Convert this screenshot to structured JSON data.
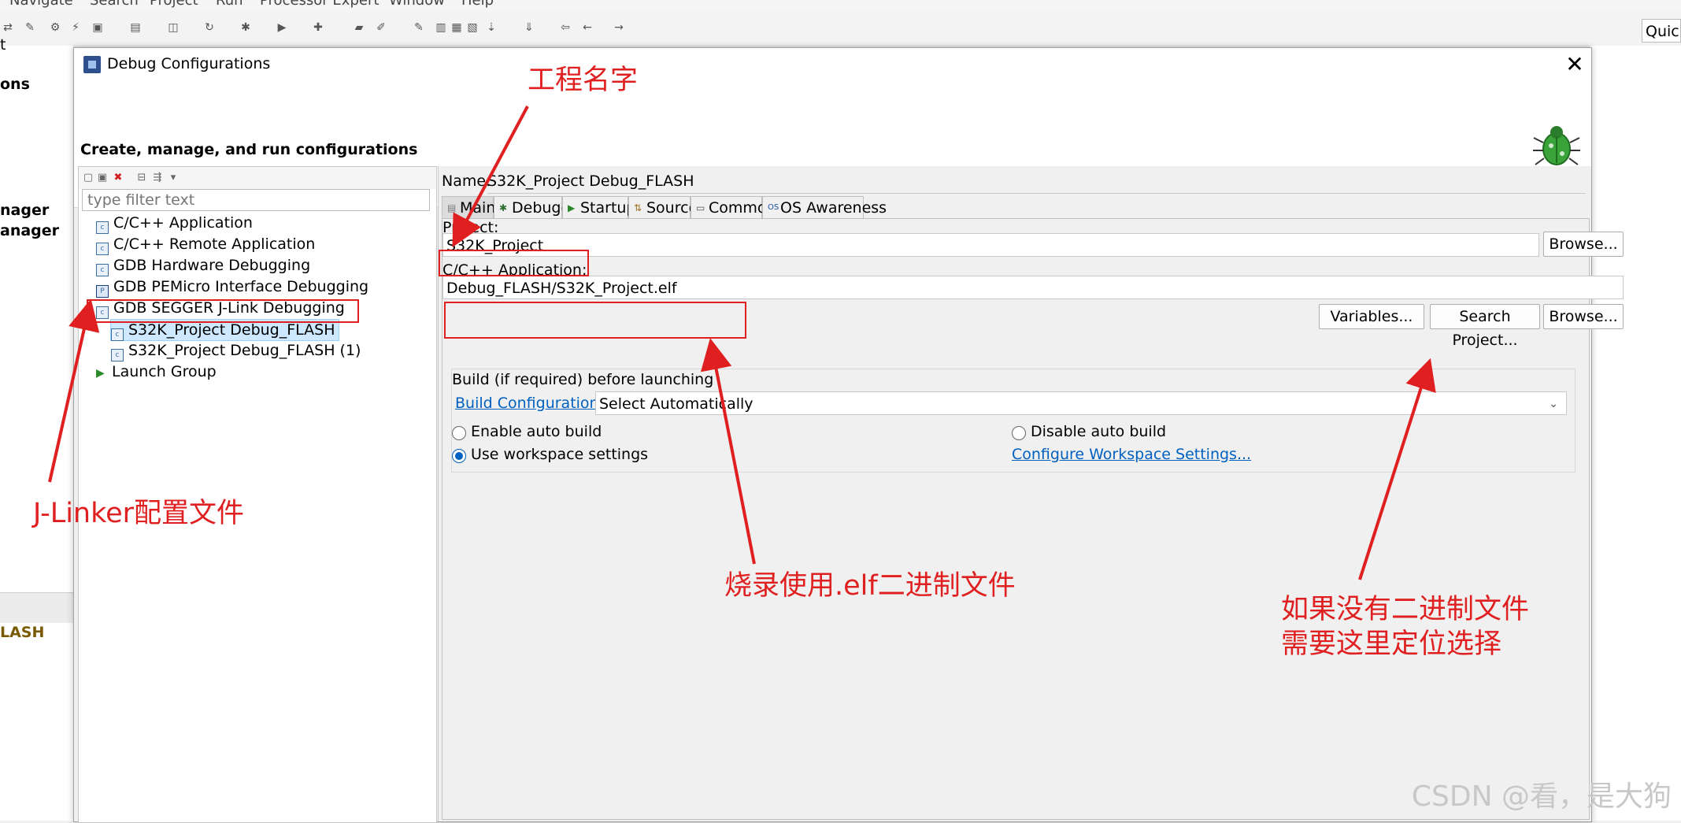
{
  "app": {
    "menubar": [
      "Navigate",
      "Search",
      "Project",
      "Run",
      "Processor Expert",
      "Window",
      "Help"
    ],
    "quick_access": "Quick",
    "bg_left_labels": [
      "ons",
      "nager",
      "anager",
      "LASH"
    ],
    "bg_tab_label": "t"
  },
  "dialog": {
    "title": "Debug Configurations",
    "header": "Create, manage, and run configurations",
    "close": "✕"
  },
  "left": {
    "filter_placeholder": "type filter text",
    "tree": [
      {
        "label": "C/C++ Application"
      },
      {
        "label": "C/C++ Remote Application"
      },
      {
        "label": "GDB Hardware Debugging"
      },
      {
        "label": "GDB PEMicro Interface Debugging"
      },
      {
        "label": "GDB SEGGER J-Link Debugging"
      },
      {
        "label": "S32K_Project Debug_FLASH"
      },
      {
        "label": "S32K_Project Debug_FLASH (1)"
      },
      {
        "label": "Launch Group"
      }
    ]
  },
  "right": {
    "name_label": "Name:",
    "name_value": "S32K_Project Debug_FLASH",
    "tabs": [
      "Main",
      "Debugger",
      "Startup",
      "Source",
      "Common",
      "OS Awareness"
    ],
    "project_label": "Project:",
    "project_value": "S32K_Project",
    "browse": "Browse...",
    "app_label": "C/C++ Application:",
    "app_value": "Debug_FLASH/S32K_Project.elf",
    "variables": "Variables...",
    "search_project": "Search Project...",
    "browse2": "Browse...",
    "build_group": "Build (if required) before launching",
    "build_config_link": "Build Configuration:",
    "build_config_value": "Select Automatically",
    "enable_auto": "Enable auto build",
    "disable_auto": "Disable auto build",
    "use_workspace": "Use workspace settings",
    "configure_ws": "Configure Workspace Settings..."
  },
  "annotations": {
    "project_name": "工程名字",
    "jlinker": "J-Linker配置文件",
    "elf": "烧录使用.elf二进制文件",
    "search_line1": "如果没有二进制文件",
    "search_line2": "需要这里定位选择"
  },
  "watermark": "CSDN @看，是大狗",
  "colors": {
    "annotation": "#e02020",
    "link": "#0060c0",
    "selection": "#cde8ff"
  }
}
